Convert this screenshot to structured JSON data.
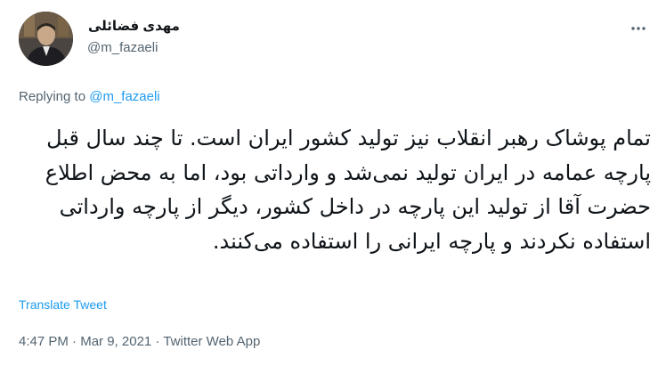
{
  "author": {
    "display_name": "مهدی فضائلی",
    "handle": "@m_fazaeli"
  },
  "reply": {
    "prefix": "Replying to",
    "mention": "@m_fazaeli"
  },
  "tweet": {
    "text": "تمام پوشاک رهبر انقلاب نیز تولید کشور ایران است. تا چند سال قبل پارچه عمامه در ایران تولید نمی‌شد و وارداتی بود، اما به محض اطلاع حضرت آقا از تولید این پارچه در داخل کشور، دیگر از پارچه وارداتی استفاده نکردند و پارچه ایرانی را استفاده می‌کنند.",
    "translate_label": "Translate Tweet",
    "time": "4:47 PM",
    "date": "Mar 9, 2021",
    "source": "Twitter Web App",
    "separator": "·"
  },
  "icons": {
    "more": "more-horizontal-icon"
  },
  "colors": {
    "accent": "#1d9bf0",
    "secondary_text": "#536471",
    "primary_text": "#0f1419"
  }
}
